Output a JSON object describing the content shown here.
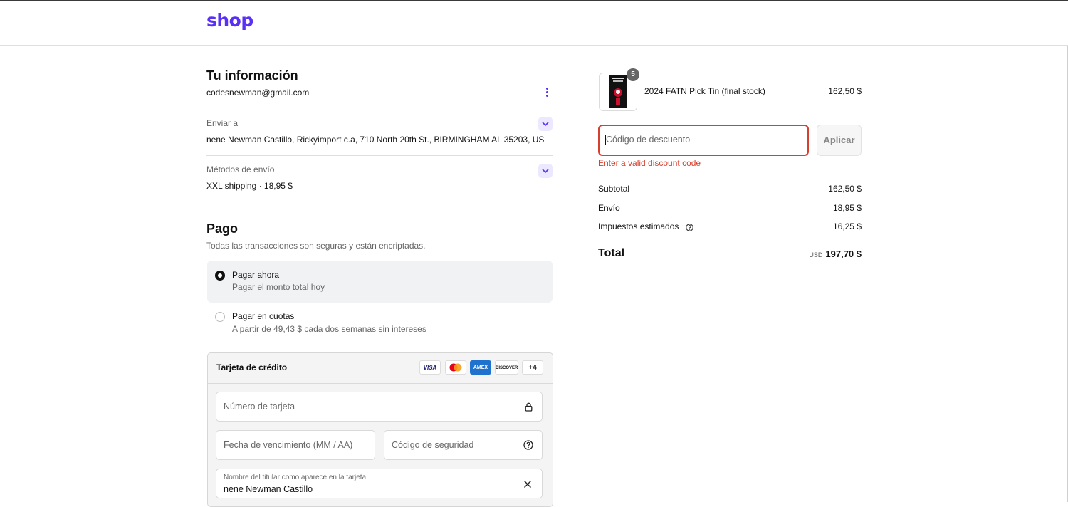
{
  "brand": {
    "logo_text": "shop",
    "color": "#5a31f4"
  },
  "info": {
    "title": "Tu información",
    "email": "codesnewman@gmail.com",
    "ship_to_label": "Enviar a",
    "ship_to_value": "nene Newman Castillo, Rickyimport c.a, 710 North 20th St., BIRMINGHAM AL 35203, US",
    "methods_label": "Métodos de envío",
    "methods_value": "XXL shipping · 18,95 $"
  },
  "payment": {
    "title": "Pago",
    "subtitle": "Todas las transacciones son seguras y están encriptadas.",
    "options": [
      {
        "title": "Pagar ahora",
        "desc": "Pagar el monto total hoy",
        "selected": true
      },
      {
        "title": "Pagar en cuotas",
        "desc": "A partir de 49,43 $ cada dos semanas sin intereses",
        "selected": false
      }
    ],
    "card": {
      "title": "Tarjeta de crédito",
      "brands": [
        "VISA",
        "mastercard",
        "AMEX",
        "DISCOVER"
      ],
      "more": "+4",
      "number_placeholder": "Número de tarjeta",
      "expiry_placeholder": "Fecha de vencimiento (MM / AA)",
      "security_placeholder": "Código de seguridad",
      "name_label": "Nombre del titular como aparece en la tarjeta",
      "name_value": "nene Newman Castillo"
    }
  },
  "summary": {
    "item": {
      "name": "2024 FATN Pick Tin (final stock)",
      "price": "162,50 $",
      "quantity": "5"
    },
    "discount_placeholder": "Código de descuento",
    "apply_label": "Aplicar",
    "error": "Enter a valid discount code",
    "error_color": "#d7402e",
    "subtotal_label": "Subtotal",
    "subtotal_value": "162,50 $",
    "shipping_label": "Envío",
    "shipping_value": "18,95 $",
    "taxes_label": "Impuestos estimados",
    "taxes_value": "16,25 $",
    "total_label": "Total",
    "currency": "USD",
    "total_value": "197,70 $"
  }
}
